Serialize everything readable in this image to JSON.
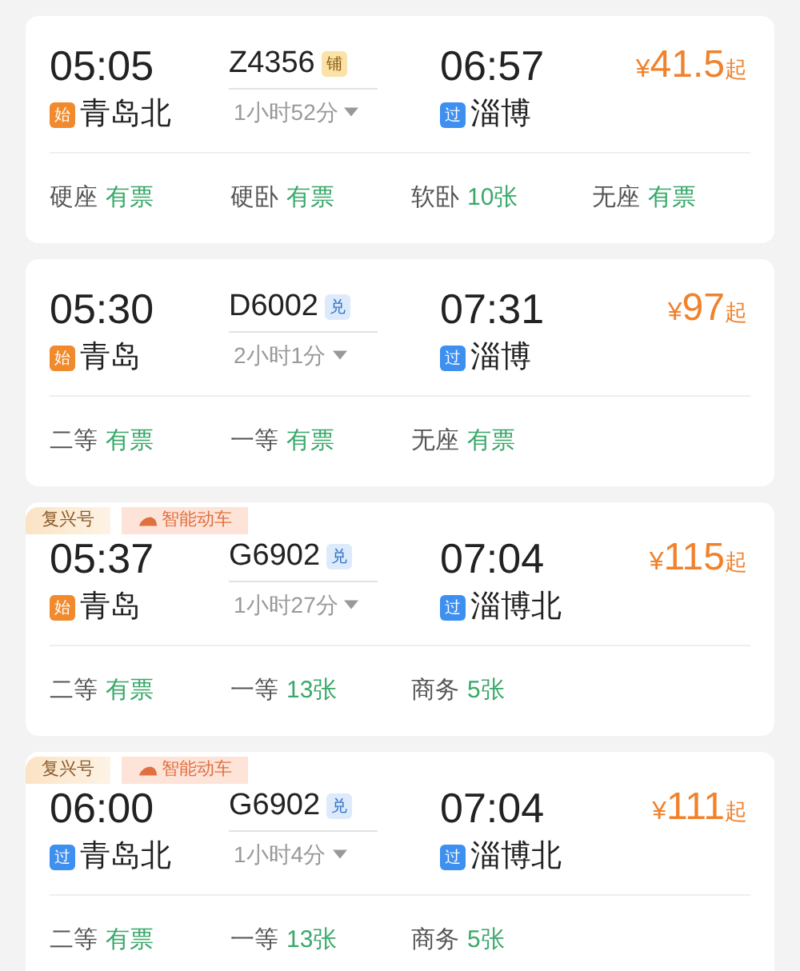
{
  "trains": [
    {
      "depart_time": "05:05",
      "depart_station": {
        "badge": "始",
        "kind": "origin",
        "name": "青岛北"
      },
      "train_no": "Z4356",
      "train_badge": {
        "text": "铺",
        "kind": "berth"
      },
      "duration": "1小时52分",
      "arrive_time": "06:57",
      "arrive_station": {
        "badge": "过",
        "kind": "passing",
        "name": "淄博"
      },
      "price": {
        "currency": "¥",
        "amount": "41.5",
        "suffix": "起"
      },
      "seats": [
        {
          "name": "硬座",
          "availability": "有票"
        },
        {
          "name": "硬卧",
          "availability": "有票"
        },
        {
          "name": "软卧",
          "availability": "10张"
        },
        {
          "name": "无座",
          "availability": "有票"
        }
      ]
    },
    {
      "depart_time": "05:30",
      "depart_station": {
        "badge": "始",
        "kind": "origin",
        "name": "青岛"
      },
      "train_no": "D6002",
      "train_badge": {
        "text": "兑",
        "kind": "exchange"
      },
      "duration": "2小时1分",
      "arrive_time": "07:31",
      "arrive_station": {
        "badge": "过",
        "kind": "passing",
        "name": "淄博"
      },
      "price": {
        "currency": "¥",
        "amount": "97",
        "suffix": "起"
      },
      "seats": [
        {
          "name": "二等",
          "availability": "有票"
        },
        {
          "name": "一等",
          "availability": "有票"
        },
        {
          "name": "无座",
          "availability": "有票"
        }
      ]
    },
    {
      "tags": [
        {
          "text": "复兴号",
          "kind": "fuxing"
        },
        {
          "text": "智能动车",
          "kind": "smart"
        }
      ],
      "depart_time": "05:37",
      "depart_station": {
        "badge": "始",
        "kind": "origin",
        "name": "青岛"
      },
      "train_no": "G6902",
      "train_badge": {
        "text": "兑",
        "kind": "exchange"
      },
      "duration": "1小时27分",
      "arrive_time": "07:04",
      "arrive_station": {
        "badge": "过",
        "kind": "passing",
        "name": "淄博北"
      },
      "price": {
        "currency": "¥",
        "amount": "115",
        "suffix": "起"
      },
      "seats": [
        {
          "name": "二等",
          "availability": "有票"
        },
        {
          "name": "一等",
          "availability": "13张"
        },
        {
          "name": "商务",
          "availability": "5张"
        }
      ]
    },
    {
      "tags": [
        {
          "text": "复兴号",
          "kind": "fuxing"
        },
        {
          "text": "智能动车",
          "kind": "smart"
        }
      ],
      "depart_time": "06:00",
      "depart_station": {
        "badge": "过",
        "kind": "passing",
        "name": "青岛北"
      },
      "train_no": "G6902",
      "train_badge": {
        "text": "兑",
        "kind": "exchange"
      },
      "duration": "1小时4分",
      "arrive_time": "07:04",
      "arrive_station": {
        "badge": "过",
        "kind": "passing",
        "name": "淄博北"
      },
      "price": {
        "currency": "¥",
        "amount": "111",
        "suffix": "起"
      },
      "seats": [
        {
          "name": "二等",
          "availability": "有票"
        },
        {
          "name": "一等",
          "availability": "13张"
        },
        {
          "name": "商务",
          "availability": "5张"
        }
      ]
    }
  ]
}
